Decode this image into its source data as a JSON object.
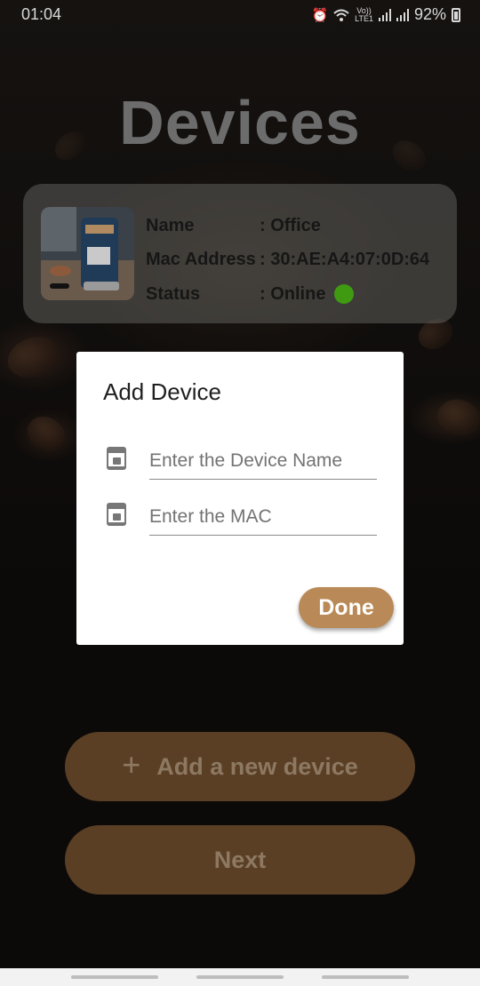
{
  "status_bar": {
    "time": "01:04",
    "lte_top": "Vo))",
    "lte_bottom": "LTE1",
    "battery": "92%"
  },
  "page": {
    "title": "Devices"
  },
  "device_card": {
    "name_label": "Name",
    "name_value": ": Office",
    "mac_label": "Mac Address",
    "mac_value": ": 30:AE:A4:07:0D:64",
    "status_label": "Status",
    "status_value": ": Online",
    "status_color": "#3f9a12"
  },
  "buttons": {
    "add_device": "Add a new device",
    "add_icon": "+",
    "next": "Next"
  },
  "dialog": {
    "title": "Add Device",
    "name_placeholder": "Enter the Device Name",
    "name_value": "",
    "mac_placeholder": "Enter the MAC",
    "mac_value": "",
    "done": "Done",
    "field_icon": "coffee-machine-icon"
  },
  "colors": {
    "accent": "#b98a57",
    "button_dim": "#5a3f25"
  }
}
